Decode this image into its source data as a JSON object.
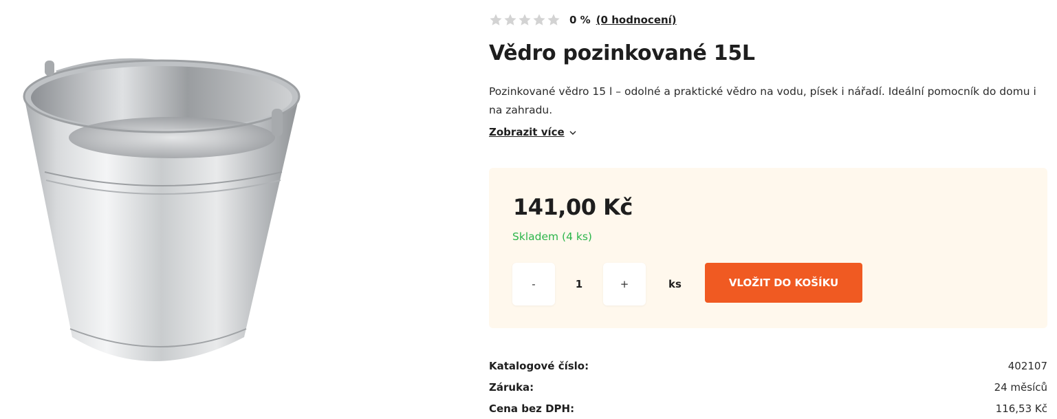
{
  "product": {
    "rating_percent": "0 %",
    "rating_count": "(0 hodnocení)",
    "stars": 0,
    "title": "Vědro pozinkované 15L",
    "description": "Pozinkované vědro 15 l – odolné a praktické vědro na vodu, písek i nářadí. Ideální pomocník do domu i na zahradu.",
    "show_more": "Zobrazit více"
  },
  "buy_box": {
    "price": "141,00 Kč",
    "stock": "Skladem (4 ks)",
    "qty_minus": "-",
    "qty_value": "1",
    "qty_plus": "+",
    "unit": "ks",
    "add_to_cart": "VLOŽIT DO KOŠÍKU"
  },
  "specs": [
    {
      "label": "Katalogové číslo:",
      "value": "402107"
    },
    {
      "label": "Záruka:",
      "value": "24 měsíců"
    },
    {
      "label": "Cena bez DPH:",
      "value": "116,53 Kč"
    }
  ],
  "colors": {
    "accent": "#f05a22",
    "stock": "#2bb54a",
    "buy_box_bg": "#fff8ed",
    "star_empty": "#d3d3d3"
  },
  "icons": {
    "star": "star-icon",
    "chevron": "chevron-down-icon"
  }
}
